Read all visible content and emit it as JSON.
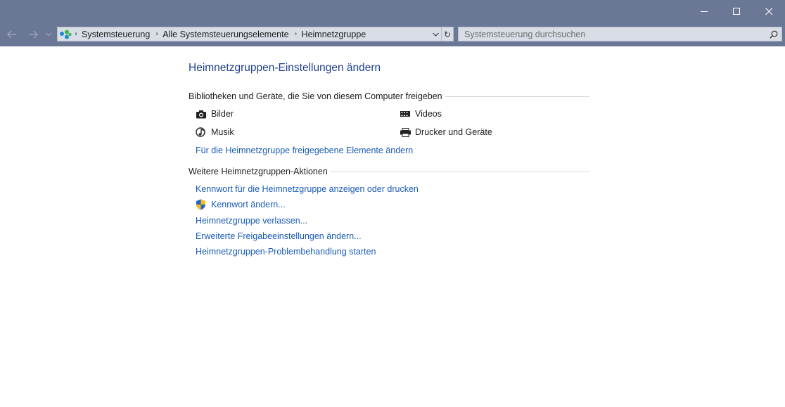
{
  "address_bar": {
    "crumbs": [
      "Systemsteuerung",
      "Alle Systemsteuerungselemente",
      "Heimnetzgruppe"
    ],
    "search_placeholder": "Systemsteuerung durchsuchen"
  },
  "content": {
    "title": "Heimnetzgruppen-Einstellungen ändern",
    "libraries_heading": "Bibliotheken und Geräte, die Sie von diesem Computer freigeben",
    "libraries": {
      "pictures": "Bilder",
      "videos": "Videos",
      "music": "Musik",
      "printers": "Drucker und Geräte"
    },
    "change_shared_link": "Für die Heimnetzgruppe freigegebene Elemente ändern",
    "actions_heading": "Weitere Heimnetzgruppen-Aktionen",
    "actions": [
      "Kennwort für die Heimnetzgruppe anzeigen oder drucken",
      "Kennwort ändern...",
      "Heimnetzgruppe verlassen...",
      "Erweiterte Freigabeeinstellungen ändern...",
      "Heimnetzgruppen-Problembehandlung starten"
    ]
  },
  "colors": {
    "chrome": "#6b7895",
    "link": "#1a5bb5",
    "title": "#1e3f8a"
  }
}
